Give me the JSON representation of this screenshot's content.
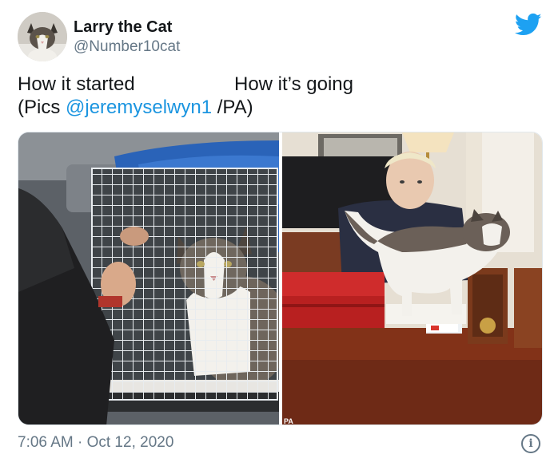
{
  "user": {
    "display_name": "Larry the Cat",
    "handle": "@Number10cat",
    "avatar_icon": "cat-avatar"
  },
  "tweet": {
    "line1_left": "How it started",
    "line1_right": "How it’s going",
    "line2_prefix": "(Pics ",
    "line2_mention": "@jeremyselwyn1",
    "line2_suffix": " /PA)"
  },
  "media": {
    "left_alt": "cat in wire cage",
    "right_alt": "cat on desk with man",
    "right_credit": "PA"
  },
  "footer": {
    "timestamp": "7:06 AM · Oct 12, 2020",
    "info_icon": "info-icon"
  },
  "colors": {
    "brand": "#1da1f2",
    "mention": "#1b95e0",
    "secondary_text": "#657786"
  }
}
